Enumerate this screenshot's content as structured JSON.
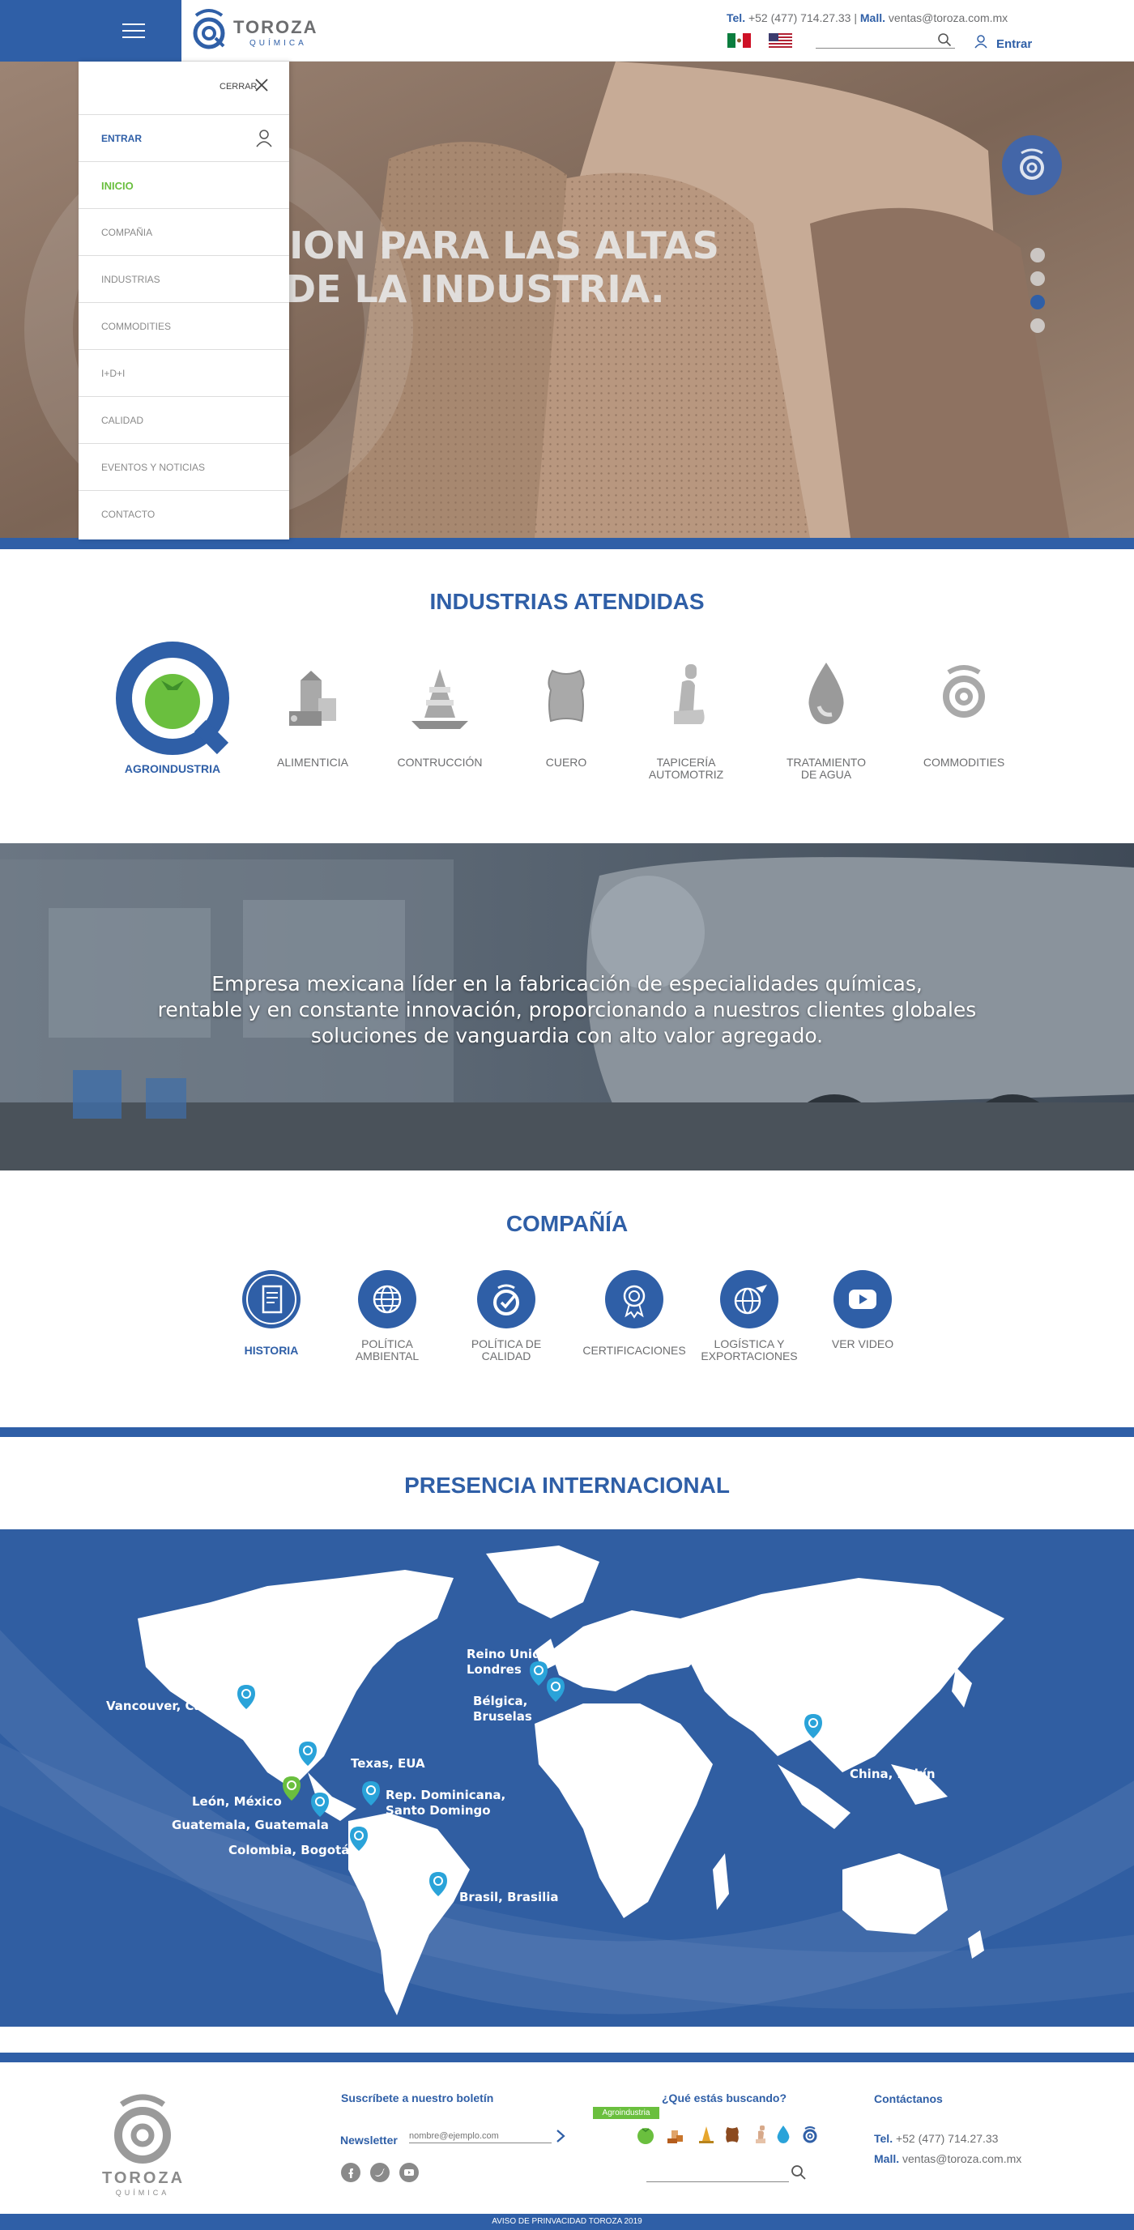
{
  "header": {
    "brand": "TOROZA",
    "brand_sub": "QUÍMICA",
    "tel_label": "Tel.",
    "tel": "+52 (477) 714.27.33",
    "separator": "|",
    "mail_label": "Mall.",
    "mail": "ventas@toroza.com.mx",
    "login": "Entrar"
  },
  "hero": {
    "headline_1": "GACION PARA LAS ALTAS",
    "headline_2": "IAS DE LA INDUSTRIA.",
    "active_slide": 3,
    "slide_count": 4
  },
  "side_menu": {
    "close": "CERRAR",
    "enter": "ENTRAR",
    "items": [
      "INICIO",
      "COMPAÑIA",
      "INDUSTRIAS",
      "COMMODITIES",
      "I+D+I",
      "CALIDAD",
      "EVENTOS Y NOTICIAS",
      "CONTACTO"
    ],
    "active_index": 0
  },
  "industries": {
    "title": "INDUSTRIAS ATENDIDAS",
    "items": [
      {
        "label": "AGROINDUSTRIA"
      },
      {
        "label": "ALIMENTICIA"
      },
      {
        "label": "CONTRUCCIÓN"
      },
      {
        "label": "CUERO"
      },
      {
        "label_1": "TAPICERÍA",
        "label_2": "AUTOMOTRIZ"
      },
      {
        "label_1": "TRATAMIENTO",
        "label_2": "DE AGUA"
      },
      {
        "label": "COMMODITIES"
      }
    ]
  },
  "mission": {
    "line_1": "Empresa mexicana líder en la fabricación de especialidades químicas,",
    "line_2": "rentable y en constante innovación, proporcionando a nuestros clientes globales",
    "line_3": "soluciones de vanguardia con alto valor agregado."
  },
  "company": {
    "title": "COMPAÑÍA",
    "items": [
      {
        "label_1": "HISTORIA",
        "label_2": ""
      },
      {
        "label_1": "POLÍTICA",
        "label_2": "AMBIENTAL"
      },
      {
        "label_1": "POLÍTICA DE",
        "label_2": "CALIDAD"
      },
      {
        "label_1": "CERTIFICACIONES",
        "label_2": ""
      },
      {
        "label_1": "LOGÍSTICA Y",
        "label_2": "EXPORTACIONES"
      },
      {
        "label_1": "VER VIDEO",
        "label_2": ""
      }
    ]
  },
  "international": {
    "title": "PRESENCIA INTERNACIONAL",
    "cities": {
      "uk_1": "Reino Unido,",
      "uk_2": "Londres",
      "be_1": "Bélgica,",
      "be_2": "Bruselas",
      "vancouver": "Vancouver, Canadá",
      "texas": "Texas, EUA",
      "leon": "León, México",
      "guatemala": "Guatemala, Guatemala",
      "colombia": "Colombia, Bogotá",
      "rd_1": "Rep. Dominicana,",
      "rd_2": "Santo Domingo",
      "brasil": "Brasil, Brasilia",
      "china": "China, Pekín"
    }
  },
  "footer": {
    "brand": "TOROZA",
    "brand_sub": "QUÍMICA",
    "newsletter_heading": "Suscríbete a nuestro boletín",
    "newsletter_label": "Newsletter",
    "newsletter_placeholder": "nombre@ejemplo.com",
    "search_heading": "¿Qué estás buscando?",
    "agro_tag": "Agroindustria",
    "contact_heading": "Contáctanos",
    "tel_label": "Tel.",
    "tel": "+52 (477) 714.27.33",
    "mail_label": "Mall.",
    "mail": "ventas@toroza.com.mx",
    "privacy": "AVISO DE PRINVACIDAD TOROZA 2019"
  },
  "colors": {
    "brand_blue": "#2f5fa7",
    "accent_green": "#6abf3e",
    "gray": "#6d6e70"
  }
}
